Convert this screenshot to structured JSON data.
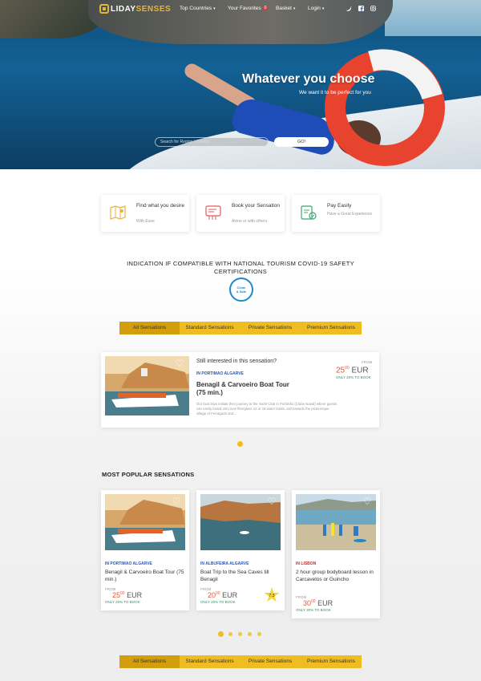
{
  "nav": {
    "logo_prefix": "H",
    "logo_main": "LIDAY",
    "logo_accent": "SENSES",
    "items": [
      {
        "label": "Top Countries"
      },
      {
        "label": "Your Favorites",
        "badge": "0"
      },
      {
        "label": "Basket"
      },
      {
        "label": "Login"
      }
    ],
    "social": [
      "twitter-icon",
      "facebook-icon",
      "instagram-icon"
    ]
  },
  "hero": {
    "title": "Whatever you choose",
    "subtitle": "We want it to be perfect for you",
    "search_placeholder": "Search for Region / Country",
    "go_label": "GO!"
  },
  "features": [
    {
      "title": "Find what you desire",
      "subtitle": "With Ease",
      "icon": "map-icon"
    },
    {
      "title": "Book your Sensation",
      "subtitle": "Alone or with others",
      "icon": "ticket-icon"
    },
    {
      "title": "Pay Easily",
      "subtitle": "Have a Great Experience",
      "icon": "payment-icon"
    }
  ],
  "covid": {
    "text": "INDICATION IF COMPATIBLE WITH NATIONAL TOURISM COVID-19 SAFETY CERTIFICATIONS",
    "badge_line1": "Clean",
    "badge_line2": "& Safe"
  },
  "tabs": [
    "All Sensations",
    "Standard Sensations",
    "Private Sensations",
    "Premium Sensations"
  ],
  "featured": {
    "prompt": "Still interested in this sensation?",
    "location": "IN PORTIMAO ALGARVE",
    "title": "Benagil & Carvoeiro Boat Tour (75 min.)",
    "description": "Our boat trips initiate their journey at the Yacht Club in Portimão (Clube Naval) where guests can easily board onto new fiberglass 12 or 18 water boats, sail towards the picturesque village of Ferragudo and...",
    "from": "FROM",
    "price": "25",
    "price_cents": "00",
    "currency": "EUR",
    "deposit": "ONLY 20% TO BOOK"
  },
  "popular": {
    "heading": "MOST POPULAR SENSATIONS",
    "items": [
      {
        "location": "IN PORTIMAO ALGARVE",
        "title": "Benagil & Carvoeiro Boat Tour (75 min.)",
        "from": "FROM",
        "price": "25",
        "cents": "00",
        "currency": "EUR",
        "deposit": "ONLY 20% TO BOOK"
      },
      {
        "location": "IN ALBUFEIRA ALGARVE",
        "title": "Boat Trip to the Sea Caves till Benagil",
        "from": "FROM",
        "price": "20",
        "cents": "00",
        "currency": "EUR",
        "deposit": "ONLY 20% TO BOOK",
        "rating": "7.3"
      },
      {
        "location": "IN LISBON",
        "title": "2 hour group bodyboard lesson in Carcavelos or Guincho",
        "from": "FROM",
        "price": "30",
        "cents": "00",
        "currency": "EUR",
        "deposit": "ONLY 30% TO BOOK"
      }
    ]
  },
  "colors": {
    "accent": "#efbd22",
    "accent_dark": "#d39e0d",
    "location_blue": "#2a57b8",
    "price": "#e65a3a",
    "deposit_green": "#1aa260"
  }
}
